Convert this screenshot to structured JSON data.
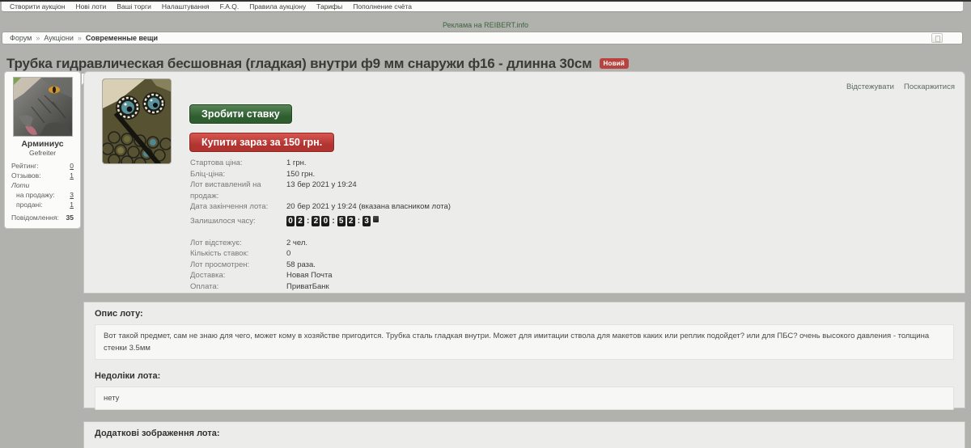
{
  "nav": {
    "items": [
      "Створити аукціон",
      "Нові лоти",
      "Ваші торги",
      "Налаштування",
      "F.A.Q.",
      "Правила аукціону",
      "Тарифы",
      "Пополнение счёта"
    ]
  },
  "ad_link": "Реклама на REIBERT.info",
  "breadcrumb": {
    "separator": "»",
    "items": [
      "Форум",
      "Аукціони",
      "Современные вещи"
    ]
  },
  "lot": {
    "title": "Трубка гидравлическая бесшовная (гладкая) внутри ф9 мм снаружи ф16 - длинна 30см",
    "badge": "Новий"
  },
  "seller": {
    "name": "Арминиус",
    "rank": "Gefreiter",
    "rating_label": "Рейтинг:",
    "rating_value": "0",
    "reviews_label": "Отзывов:",
    "reviews_value": "1",
    "lots_label": "Лоти",
    "forsale_label": "на продажу:",
    "forsale_value": "3",
    "sold_label": "продані:",
    "sold_value": "1",
    "messages_label": "Повідомлення:",
    "messages_value": "35"
  },
  "actions": {
    "watch": "Відстежувати",
    "report": "Поскаржитися",
    "bid": "Зробити ставку",
    "buy": "Купити зараз за 150 грн."
  },
  "details": {
    "top_rows": [
      {
        "label": "Стартова ціна:",
        "value": "1 грн."
      },
      {
        "label": "Бліц-ціна:",
        "value": "150 грн."
      },
      {
        "label": "Лот виставлений на продаж:",
        "value": "13 бер 2021 у 19:24"
      },
      {
        "label": "Дата закінчення лота:",
        "value": "20 бер 2021 у 19:24 (вказана власником лота)"
      }
    ],
    "time_left_label": "Залишилося часу:",
    "countdown": {
      "sep": ":",
      "d1": "0",
      "d2": "2",
      "d3": "2",
      "d4": "0",
      "d5": "5",
      "d6": "2",
      "d7": "3"
    },
    "bottom_rows": [
      {
        "label": "Лот відстежує:",
        "value": "2 чел."
      },
      {
        "label": "Кількість ставок:",
        "value": "0"
      },
      {
        "label": "Лот просмотрен:",
        "value": "58 раза."
      },
      {
        "label": "Доставка:",
        "value": "Новая Почта"
      },
      {
        "label": "Оплата:",
        "value": "ПриватБанк"
      }
    ]
  },
  "description": {
    "heading": "Опис лоту:",
    "text": "Вот такой предмет, сам не знаю для чего, может кому в хозяйстве пригодится. Трубка сталь гладкая внутри. Может для имитации ствола для макетов каких или реплик подойдет? или для ПБС? очень высокого давления - толщина стенки 3.5мм"
  },
  "flaws": {
    "heading": "Недоліки лота:",
    "text": "нету"
  },
  "extra_images": {
    "heading": "Додаткові зображення лота:"
  },
  "colors": {
    "page_bg": "#b1b1ae",
    "panel_bg": "#ececea",
    "bar_bg": "#fbfbfa",
    "accent_green": "#2e5d30",
    "accent_red": "#b13431",
    "badge_red": "#b8423d",
    "link_green": "#3c663e"
  }
}
